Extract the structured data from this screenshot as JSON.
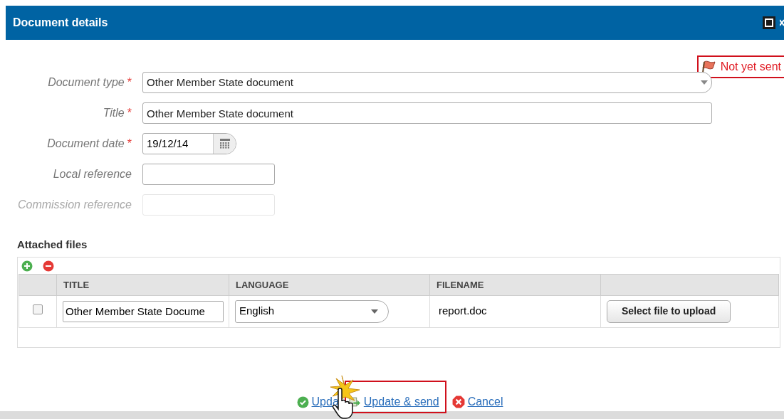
{
  "dialog": {
    "title": "Document details",
    "status": {
      "label": "Not yet sent"
    },
    "fields": [
      {
        "label": "Document type",
        "required_mark": "*",
        "kind": "select",
        "value": "Other Member State document",
        "disabled": false
      },
      {
        "label": "Title",
        "required_mark": "*",
        "kind": "text",
        "value": "Other Member State document",
        "disabled": false
      },
      {
        "label": "Document date",
        "required_mark": "*",
        "kind": "date",
        "value": "19/12/14",
        "disabled": false
      },
      {
        "label": "Local reference",
        "kind": "short",
        "disabled": false
      },
      {
        "label": "Commission reference",
        "kind": "short",
        "disabled": true
      }
    ],
    "attachments": {
      "title": "Attached files",
      "columns": [
        "TITLE",
        "LANGUAGE",
        "FILENAME"
      ],
      "rows": [
        {
          "checked": false,
          "title": "Other Member State Docume",
          "language": "English",
          "filename": "report.doc",
          "button": "Select file to upload"
        }
      ]
    },
    "actions": [
      {
        "kind": "confirm",
        "label": "Upda",
        "highlighted": false
      },
      {
        "kind": "send",
        "label": "Update & send",
        "highlighted": true
      },
      {
        "kind": "cancel",
        "label": "Cancel",
        "highlighted": false
      }
    ]
  }
}
